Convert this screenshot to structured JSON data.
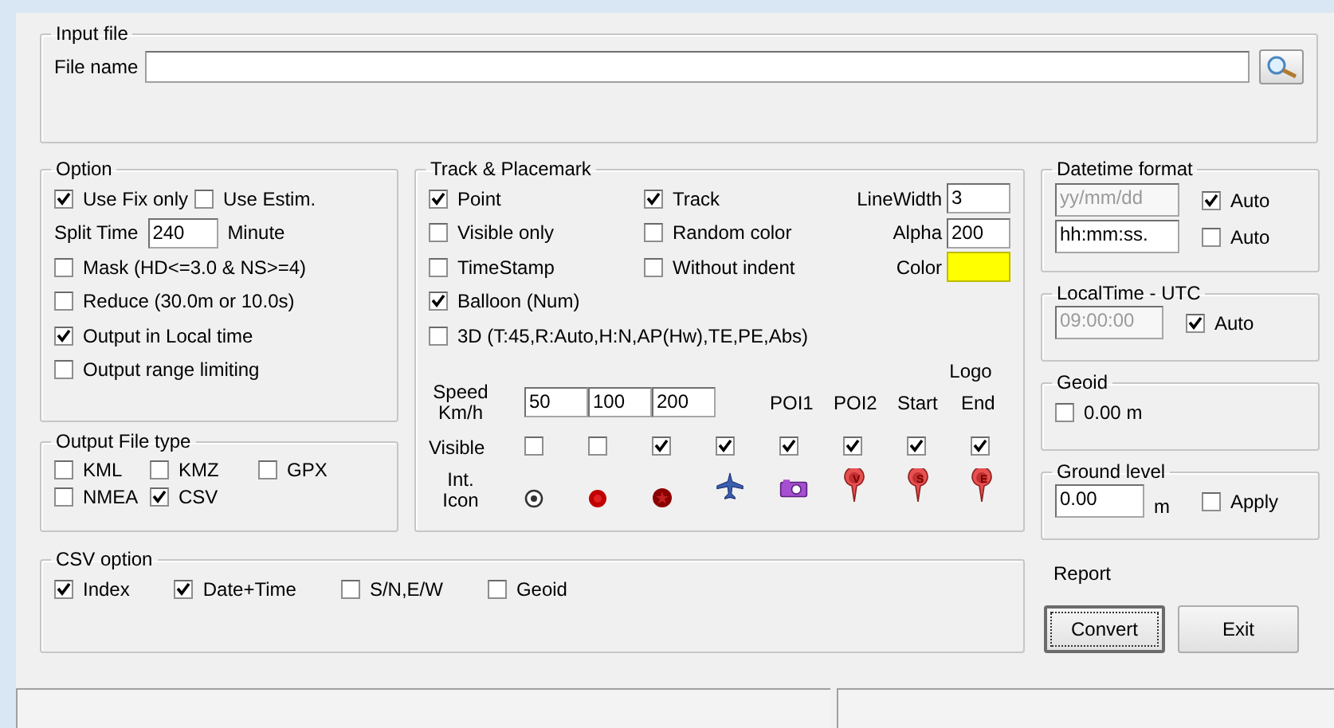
{
  "input_file": {
    "title": "Input file",
    "label": "File name"
  },
  "option": {
    "title": "Option",
    "top_checks": [
      {
        "label": "Use Fix only",
        "checked": true
      },
      {
        "label": "Use Estim.",
        "checked": false
      }
    ],
    "split_time": {
      "label": "Split Time",
      "value": "240",
      "unit": "Minute"
    },
    "checks": [
      {
        "label": "Mask (HD<=3.0 & NS>=4)",
        "checked": false
      },
      {
        "label": "Reduce (30.0m or 10.0s)",
        "checked": false
      },
      {
        "label": "Output in Local time",
        "checked": true
      },
      {
        "label": "Output range limiting",
        "checked": false
      }
    ]
  },
  "output_file_type": {
    "title": "Output File type",
    "options": [
      {
        "label": "KML",
        "checked": false
      },
      {
        "label": "KMZ",
        "checked": false
      },
      {
        "label": "GPX",
        "checked": false
      },
      {
        "label": "NMEA",
        "checked": false
      },
      {
        "label": "CSV",
        "checked": true
      }
    ]
  },
  "track": {
    "title": "Track & Placemark",
    "grid": [
      [
        {
          "kind": "check",
          "label": "Point",
          "checked": true
        },
        {
          "kind": "check",
          "label": "Track",
          "checked": true
        },
        {
          "kind": "number",
          "label": "LineWidth",
          "value": "3"
        }
      ],
      [
        {
          "kind": "check",
          "label": "Visible only",
          "checked": false
        },
        {
          "kind": "check",
          "label": "Random color",
          "checked": false
        },
        {
          "kind": "number",
          "label": "Alpha",
          "value": "200"
        }
      ],
      [
        {
          "kind": "check",
          "label": "TimeStamp",
          "checked": false
        },
        {
          "kind": "check",
          "label": "Without indent",
          "checked": false
        },
        {
          "kind": "color",
          "label": "Color",
          "color": "#ffff00"
        }
      ],
      [
        {
          "kind": "check",
          "label": "Balloon (Num)",
          "checked": true
        }
      ],
      [
        {
          "kind": "check",
          "label": "3D (T:45,R:Auto,H:N,AP(Hw),TE,PE,Abs)",
          "checked": false
        }
      ]
    ],
    "speed": {
      "label": "Speed Km/h",
      "values": [
        "50",
        "100",
        "200"
      ]
    },
    "logo_label": "Logo",
    "visible_label": "Visible",
    "icon_label": "Int. Icon",
    "columns": [
      {
        "visible": false,
        "kind": "dot"
      },
      {
        "visible": false,
        "kind": "red-circle"
      },
      {
        "visible": true,
        "kind": "star"
      },
      {
        "visible": true,
        "kind": "plane"
      },
      {
        "header": "POI1",
        "visible": true,
        "kind": "camera"
      },
      {
        "header": "POI2",
        "visible": true,
        "kind": "pin",
        "letter": "V"
      },
      {
        "header": "Start",
        "visible": true,
        "kind": "pin",
        "letter": "S"
      },
      {
        "header": "End",
        "visible": true,
        "kind": "pin",
        "letter": "E"
      }
    ]
  },
  "csv_option": {
    "title": "CSV option",
    "options": [
      {
        "label": "Index",
        "checked": true
      },
      {
        "label": "Date+Time",
        "checked": true
      },
      {
        "label": "S/N,E/W",
        "checked": false
      },
      {
        "label": "Geoid",
        "checked": false
      }
    ]
  },
  "datetime_format": {
    "title": "Datetime format",
    "fields": [
      {
        "value": "yy/mm/dd",
        "disabled": true,
        "auto": {
          "label": "Auto",
          "checked": true
        }
      },
      {
        "value": "hh:mm:ss.",
        "disabled": false,
        "auto": {
          "label": "Auto",
          "checked": false
        }
      }
    ]
  },
  "local_time_utc": {
    "title": "LocalTime - UTC",
    "value": "09:00:00",
    "disabled": true,
    "auto": {
      "label": "Auto",
      "checked": true
    }
  },
  "geoid": {
    "title": "Geoid",
    "check": {
      "label": "0.00 m",
      "checked": false
    }
  },
  "ground_level": {
    "title": "Ground level",
    "value": "0.00",
    "unit": "m",
    "apply": {
      "label": "Apply",
      "checked": false
    }
  },
  "report": {
    "label": "Report"
  },
  "buttons": [
    {
      "label": "Convert",
      "focused": true
    },
    {
      "label": "Exit",
      "focused": false
    }
  ]
}
